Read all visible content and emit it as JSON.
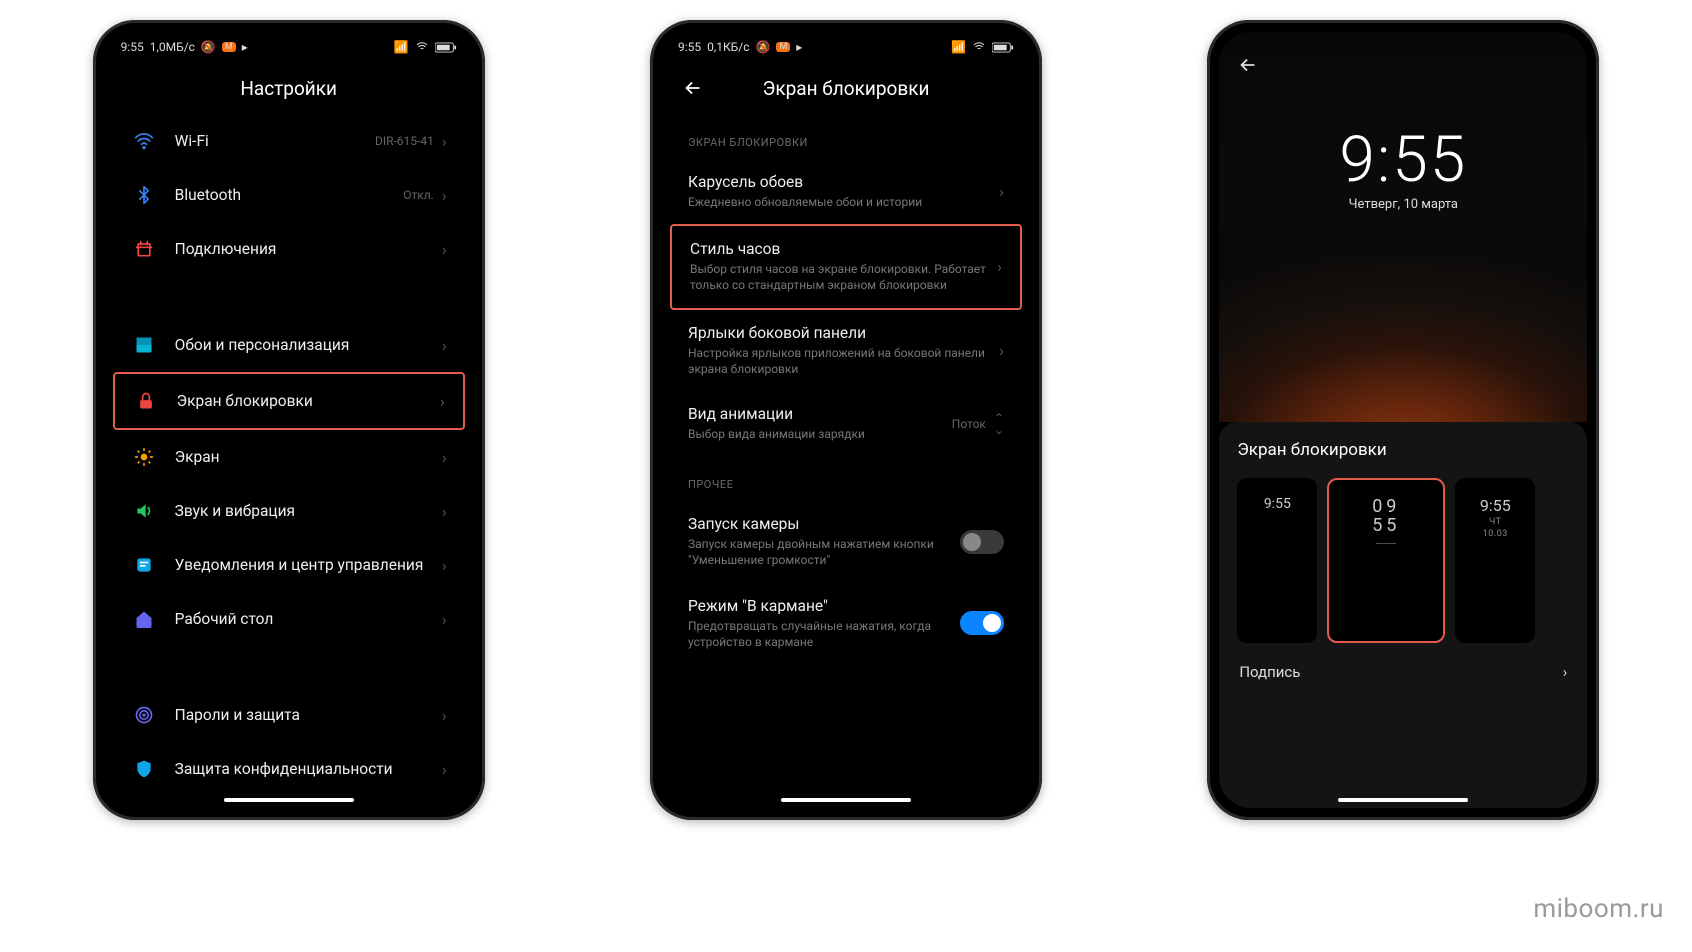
{
  "watermark": "miboom.ru",
  "phone1": {
    "status": {
      "time": "9:55",
      "speed": "1,0МБ/с"
    },
    "title": "Настройки",
    "items": [
      {
        "label": "Wi-Fi",
        "value": "DIR-615-41",
        "icon": "wifi",
        "color": "#3b82f6",
        "hl": false,
        "valueOnRight": true
      },
      {
        "label": "Bluetooth",
        "value": "Откл.",
        "icon": "bluetooth",
        "color": "#3b82f6",
        "hl": false,
        "valueOnRight": true
      },
      {
        "label": "Подключения",
        "value": "",
        "icon": "connections",
        "color": "#ef4444",
        "hl": false
      },
      {
        "label": "Обои и персонализация",
        "value": "",
        "icon": "wallpaper",
        "color": "#06b6d4",
        "hl": false,
        "gapBefore": true
      },
      {
        "label": "Экран блокировки",
        "value": "",
        "icon": "lock",
        "color": "#ef4444",
        "hl": true
      },
      {
        "label": "Экран",
        "value": "",
        "icon": "brightness",
        "color": "#f59e0b",
        "hl": false
      },
      {
        "label": "Звук и вибрация",
        "value": "",
        "icon": "sound",
        "color": "#22c55e",
        "hl": false
      },
      {
        "label": "Уведомления и центр управления",
        "value": "",
        "icon": "notifications",
        "color": "#0ea5e9",
        "hl": false
      },
      {
        "label": "Рабочий стол",
        "value": "",
        "icon": "home",
        "color": "#6366f1",
        "hl": false
      },
      {
        "label": "Пароли и защита",
        "value": "",
        "icon": "fingerprint",
        "color": "#6366f1",
        "hl": false,
        "gapBefore": true
      },
      {
        "label": "Защита конфиденциальности",
        "value": "",
        "icon": "shield",
        "color": "#0ea5e9",
        "hl": false
      }
    ]
  },
  "phone2": {
    "status": {
      "time": "9:55",
      "speed": "0,1КБ/с"
    },
    "title": "Экран блокировки",
    "section1": "ЭКРАН БЛОКИРОВКИ",
    "section2": "ПРОЧЕЕ",
    "items1": [
      {
        "label": "Карусель обоев",
        "desc": "Ежедневно обновляемые обои и истории",
        "hl": false,
        "chev": true
      },
      {
        "label": "Стиль часов",
        "desc": "Выбор стиля часов на экране блокировки. Работает только со стандартным экраном блокировки",
        "hl": true,
        "chev": true
      },
      {
        "label": "Ярлыки боковой панели",
        "desc": "Настройка ярлыков приложений на боковой панели экрана блокировки",
        "hl": false,
        "chev": true
      },
      {
        "label": "Вид анимации",
        "desc": "Выбор вида анимации зарядки",
        "hl": false,
        "value": "Поток",
        "expand": true
      }
    ],
    "items2": [
      {
        "label": "Запуск камеры",
        "desc": "Запуск камеры двойным нажатием кнопки \"Уменьшение громкости\"",
        "toggle": false
      },
      {
        "label": "Режим \"В кармане\"",
        "desc": "Предотвращать случайные нажатия, когда устройство в кармане",
        "toggle": true
      }
    ]
  },
  "phone3": {
    "clock": "9:55",
    "date": "Четверг, 10 марта",
    "panelTitle": "Экран блокировки",
    "signatureLabel": "Подпись",
    "thumbs": [
      {
        "line1": "9:55",
        "line2": ""
      },
      {
        "line1": "09",
        "line2": "55"
      },
      {
        "line1": "9:55",
        "line2": "ЧТ",
        "line3": "10.03"
      }
    ]
  }
}
